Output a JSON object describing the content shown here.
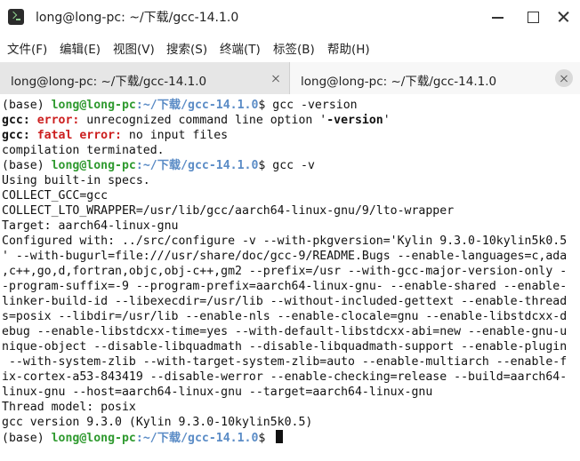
{
  "window": {
    "title": "long@long-pc: ~/下载/gcc-14.1.0"
  },
  "menu": [
    "文件(F)",
    "编辑(E)",
    "视图(V)",
    "搜索(S)",
    "终端(T)",
    "标签(B)",
    "帮助(H)"
  ],
  "tabs": [
    {
      "label": "long@long-pc: ~/下载/gcc-14.1.0"
    },
    {
      "label": "long@long-pc: ~/下载/gcc-14.1.0"
    }
  ],
  "prompt": {
    "env": "(base) ",
    "user": "long@long-pc",
    "sep": ":",
    "path": "~/下载/gcc-14.1.0",
    "sigil": "$ "
  },
  "terminal": {
    "cmd1": "gcc -version",
    "err1_prefix": "gcc: ",
    "err1_label": "error:",
    "err1_text": " unrecognized command line option '",
    "err1_opt": "-version",
    "err1_close": "'",
    "err2_prefix": "gcc: ",
    "err2_label": "fatal error:",
    "err2_text": " no input files",
    "out1": "compilation terminated.",
    "cmd2": "gcc -v",
    "out_lines": [
      "Using built-in specs.",
      "COLLECT_GCC=gcc",
      "COLLECT_LTO_WRAPPER=/usr/lib/gcc/aarch64-linux-gnu/9/lto-wrapper",
      "Target: aarch64-linux-gnu",
      "Configured with: ../src/configure -v --with-pkgversion='Kylin 9.3.0-10kylin5k0.5",
      "' --with-bugurl=file:///usr/share/doc/gcc-9/README.Bugs --enable-languages=c,ada",
      ",c++,go,d,fortran,objc,obj-c++,gm2 --prefix=/usr --with-gcc-major-version-only -",
      "-program-suffix=-9 --program-prefix=aarch64-linux-gnu- --enable-shared --enable-",
      "linker-build-id --libexecdir=/usr/lib --without-included-gettext --enable-thread",
      "s=posix --libdir=/usr/lib --enable-nls --enable-clocale=gnu --enable-libstdcxx-d",
      "ebug --enable-libstdcxx-time=yes --with-default-libstdcxx-abi=new --enable-gnu-u",
      "nique-object --disable-libquadmath --disable-libquadmath-support --enable-plugin",
      " --with-system-zlib --with-target-system-zlib=auto --enable-multiarch --enable-f",
      "ix-cortex-a53-843419 --disable-werror --enable-checking=release --build=aarch64-",
      "linux-gnu --host=aarch64-linux-gnu --target=aarch64-linux-gnu",
      "Thread model: posix",
      "gcc version 9.3.0 (Kylin 9.3.0-10kylin5k0.5)"
    ]
  }
}
